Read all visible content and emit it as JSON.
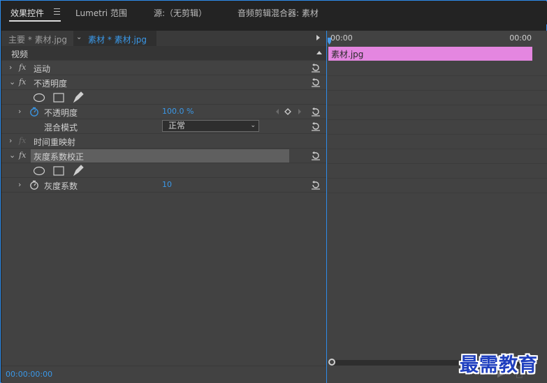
{
  "tabs": [
    {
      "label": "效果控件",
      "active": true
    },
    {
      "label": "Lumetri 范围",
      "active": false
    },
    {
      "label": "源:（无剪辑）",
      "active": false
    },
    {
      "label": "音频剪辑混合器: 素材",
      "active": false
    }
  ],
  "clip_tabs": {
    "master": "主要 * 素材.jpg",
    "sequence": "素材 * 素材.jpg"
  },
  "timeline": {
    "time_start": "00:00",
    "time_end": "00:00",
    "clip_name": "素材.jpg",
    "clip_color": "#e486e0"
  },
  "section_header": "视频",
  "rows": {
    "motion": "运动",
    "opacity": "不透明度",
    "opacity_prop": "不透明度",
    "opacity_value": "100.0 %",
    "blend_mode_label": "混合模式",
    "blend_mode_value": "正常",
    "time_remap": "时间重映射",
    "gamma_effect": "灰度系数校正",
    "gamma_prop": "灰度系数",
    "gamma_value": "10"
  },
  "status": {
    "timecode": "00:00:00:00"
  },
  "watermark": "最需教育",
  "colors": {
    "accent": "#2d8ceb",
    "value_blue": "#3a98e8"
  }
}
